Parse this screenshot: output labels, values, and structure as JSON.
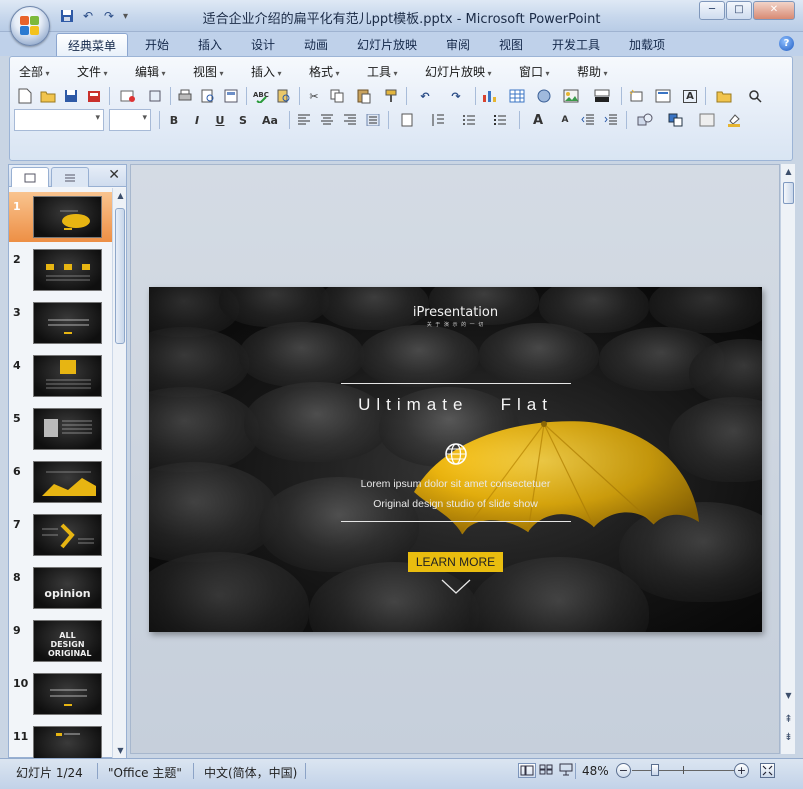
{
  "window": {
    "title": "适合企业介绍的扁平化有范儿ppt模板.pptx - Microsoft PowerPoint",
    "controls": {
      "minimize": "─",
      "maximize": "□",
      "close": "✕"
    }
  },
  "ribbon_tabs": [
    "经典菜单",
    "开始",
    "插入",
    "设计",
    "动画",
    "幻灯片放映",
    "审阅",
    "视图",
    "开发工具",
    "加载项"
  ],
  "menus": [
    "全部",
    "文件",
    "编辑",
    "视图",
    "插入",
    "格式",
    "工具",
    "幻灯片放映",
    "窗口",
    "帮助"
  ],
  "toolbar": {
    "bold": "B",
    "italic": "I",
    "underline": "U",
    "shadow": "S",
    "change_case": "Aa",
    "grow_font": "A",
    "shrink_font": "A",
    "font_color": "A",
    "textbox": "A"
  },
  "slides_panel": {
    "close": "✕",
    "thumbnails": [
      {
        "number": "1",
        "caption": ""
      },
      {
        "number": "2",
        "caption": ""
      },
      {
        "number": "3",
        "caption": ""
      },
      {
        "number": "4",
        "caption": ""
      },
      {
        "number": "5",
        "caption": ""
      },
      {
        "number": "6",
        "caption": ""
      },
      {
        "number": "7",
        "caption": ""
      },
      {
        "number": "8",
        "caption": "opinion"
      },
      {
        "number": "9",
        "caption": "ALL DESIGN ORIGINAL"
      },
      {
        "number": "10",
        "caption": ""
      },
      {
        "number": "11",
        "caption": ""
      }
    ]
  },
  "slide": {
    "brand": "iPresentation",
    "brand_sub": "关 于 演 示 的 一 切",
    "title": "Ultimate   Flat",
    "line1": "Lorem ipsum dolor sit amet consectetuer",
    "line2": "Original design studio of slide show",
    "button": "LEARN MORE"
  },
  "status": {
    "slide_info": "幻灯片 1/24",
    "theme": "\"Office 主题\"",
    "language": "中文(简体，中国)",
    "zoom": "48%"
  },
  "colors": {
    "accent_yellow": "#e9bd0f",
    "selected_thumb": "#ed8f45",
    "ribbon_bg": "#dfe9f5"
  }
}
